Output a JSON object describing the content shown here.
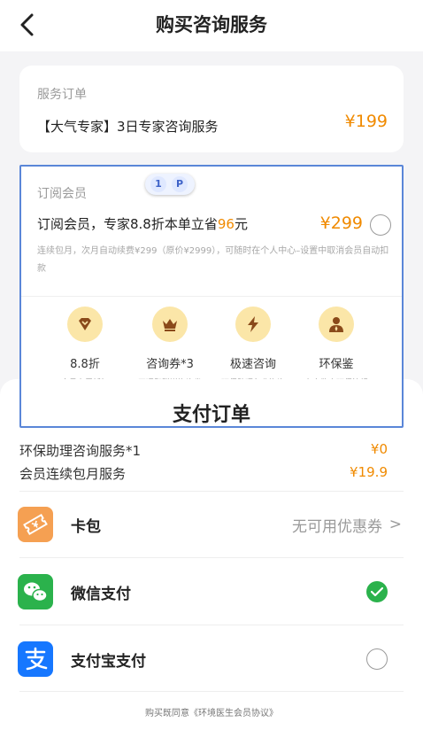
{
  "nav": {
    "title": "购买咨询服务"
  },
  "order": {
    "label": "服务订单",
    "service": "【大气专家】3日专家咨询服务",
    "price": "¥199"
  },
  "member": {
    "label": "订阅会员",
    "badge": [
      "1",
      "P"
    ],
    "headline_prefix": "订阅会员，专家8.8折本单立省",
    "headline_amount": "96",
    "headline_suffix": "元",
    "price": "¥299",
    "note": "连续包月，次月自动续费¥299（原价¥2999），可随时在个人中心–设置中取消会员自动扣款",
    "benefits": [
      {
        "icon": "diamond-icon",
        "title": "8.8折",
        "sub": "会员专属折扣"
      },
      {
        "icon": "crown-icon",
        "title": "咨询券*3",
        "sub": "开通即赠送咨询券"
      },
      {
        "icon": "lightning-icon",
        "title": "极速咨询",
        "sub": "环保助理免费咨询"
      },
      {
        "icon": "expert-icon",
        "title": "环保鉴",
        "sub": "专家鉴定环保法规"
      }
    ]
  },
  "sheet": {
    "title": "支付订单",
    "lines": [
      {
        "label": "环保助理咨询服务*1",
        "value": "¥0"
      },
      {
        "label": "会员连续包月服务",
        "value": "¥19.9"
      }
    ],
    "coupon": {
      "label": "卡包",
      "value": "无可用优惠券",
      "chevron": ">"
    },
    "wechat": {
      "label": "微信支付",
      "selected": true
    },
    "alipay": {
      "label": "支付宝支付",
      "selected": false
    },
    "agreement": "购买既同意《环境医生会员协议》"
  },
  "colors": {
    "accent": "#f08a00",
    "wechat_green": "#2bb24c",
    "alipay_blue": "#1677ff",
    "coupon_orange": "#f5a052",
    "selection_outline": "#5a86d8"
  }
}
